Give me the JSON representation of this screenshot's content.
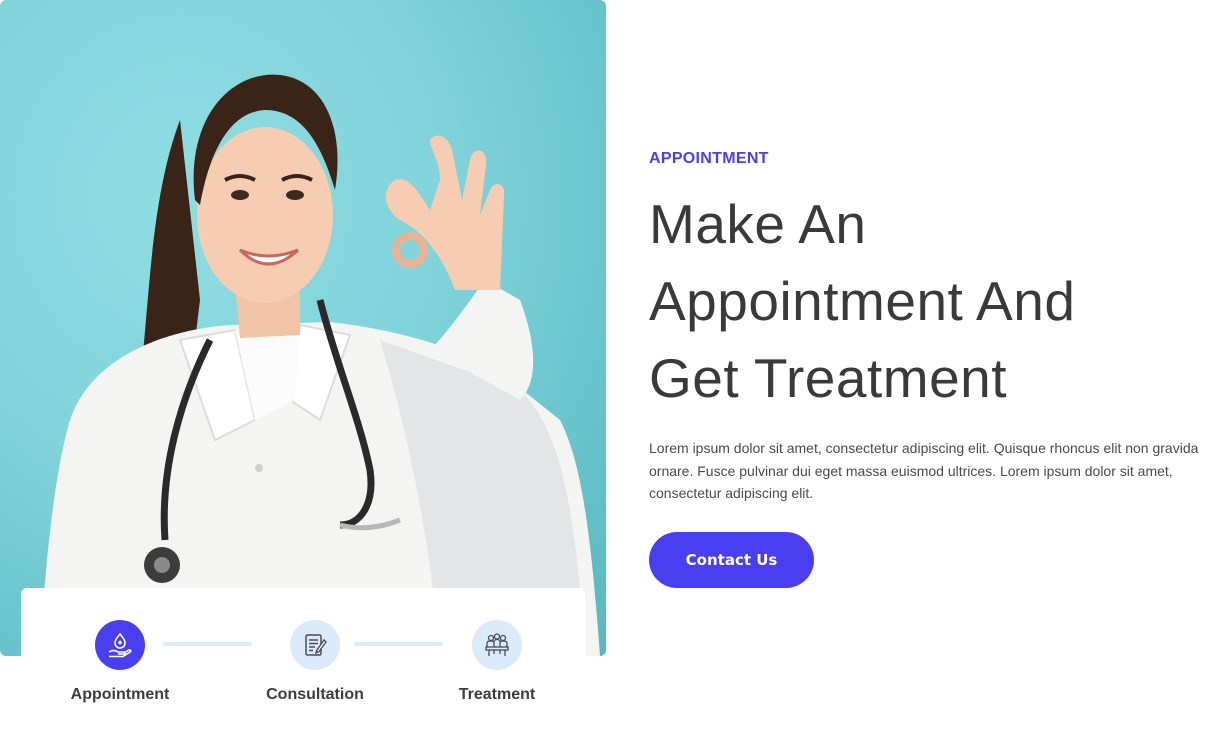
{
  "hero": {
    "image_alt": "Smiling doctor in white coat with stethoscope making OK gesture"
  },
  "steps": [
    {
      "label": "Appointment",
      "icon": "hand-heart-icon",
      "active": true
    },
    {
      "label": "Consultation",
      "icon": "clipboard-pen-icon",
      "active": false
    },
    {
      "label": "Treatment",
      "icon": "team-meeting-icon",
      "active": false
    }
  ],
  "section": {
    "eyebrow": "APPOINTMENT",
    "headline_lines": [
      "Make An",
      "Appointment And",
      "Get Treatment"
    ],
    "body": "Lorem ipsum dolor sit amet, consectetur adipiscing elit. Quisque rhoncus elit non gravida ornare. Fusce pulvinar dui eget massa euismod ultrices. Lorem ipsum dolor sit amet, consectetur adipiscing elit.",
    "cta_label": "Contact Us"
  },
  "colors": {
    "accent": "#4a3ff0",
    "step_idle": "#dcebfb",
    "heading": "#3a3a3a",
    "image_bg": "#7fd3d9"
  }
}
